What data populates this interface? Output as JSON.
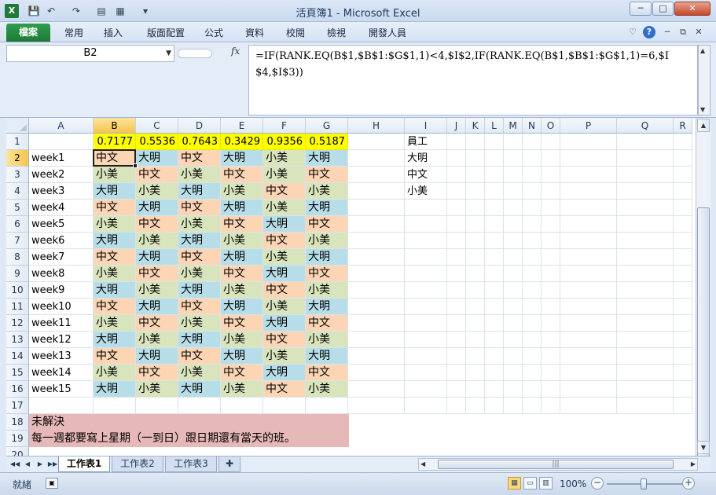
{
  "window": {
    "title": "活頁簿1 - Microsoft Excel",
    "minimize_label": "─",
    "maximize_label": "□",
    "close_label": "✕"
  },
  "quick_access": {
    "save_icon": "💾",
    "undo_icon": "↶",
    "redo_icon": "↷",
    "customize_icon": "▾"
  },
  "ribbon": {
    "tabs": [
      "檔案",
      "常用",
      "插入",
      "版面配置",
      "公式",
      "資料",
      "校閱",
      "檢視",
      "開發人員"
    ],
    "help_label": "?"
  },
  "formula_bar": {
    "name_box": "B2",
    "fx_label": "fx",
    "formula": "=IF(RANK.EQ(B$1,$B$1:$G$1,1)<4,$I$2,IF(RANK.EQ(B$1,$B$1:$G$1,1)=6,$I$4,$I$3))"
  },
  "grid": {
    "columns": [
      "A",
      "B",
      "C",
      "D",
      "E",
      "F",
      "G",
      "H",
      "I",
      "J",
      "K",
      "L",
      "M",
      "N",
      "O",
      "P",
      "Q",
      "R"
    ],
    "selected_column": "B",
    "selected_row": 2,
    "row_numbers": [
      1,
      2,
      3,
      4,
      5,
      6,
      7,
      8,
      9,
      10,
      11,
      12,
      13,
      14,
      15,
      16,
      17,
      18,
      19,
      20
    ],
    "row1_values": [
      "0.7177",
      "0.5536",
      "0.7643",
      "0.3429",
      "0.9356",
      "0.5187"
    ],
    "week_labels": [
      "week1",
      "week2",
      "week3",
      "week4",
      "week5",
      "week6",
      "week7",
      "week8",
      "week9",
      "week10",
      "week11",
      "week12",
      "week13",
      "week14",
      "week15"
    ],
    "schedule": [
      [
        "中文",
        "大明",
        "中文",
        "大明",
        "小美",
        "大明"
      ],
      [
        "小美",
        "中文",
        "小美",
        "中文",
        "小美",
        "中文"
      ],
      [
        "大明",
        "小美",
        "大明",
        "小美",
        "中文",
        "小美"
      ],
      [
        "中文",
        "大明",
        "中文",
        "大明",
        "小美",
        "大明"
      ],
      [
        "小美",
        "中文",
        "小美",
        "中文",
        "大明",
        "中文"
      ],
      [
        "大明",
        "小美",
        "大明",
        "小美",
        "中文",
        "小美"
      ],
      [
        "中文",
        "大明",
        "中文",
        "大明",
        "小美",
        "大明"
      ],
      [
        "小美",
        "中文",
        "小美",
        "中文",
        "大明",
        "中文"
      ],
      [
        "大明",
        "小美",
        "大明",
        "小美",
        "中文",
        "小美"
      ],
      [
        "中文",
        "大明",
        "中文",
        "大明",
        "小美",
        "大明"
      ],
      [
        "小美",
        "中文",
        "小美",
        "中文",
        "大明",
        "中文"
      ],
      [
        "大明",
        "小美",
        "大明",
        "小美",
        "中文",
        "小美"
      ],
      [
        "中文",
        "大明",
        "中文",
        "大明",
        "小美",
        "大明"
      ],
      [
        "小美",
        "中文",
        "小美",
        "中文",
        "大明",
        "中文"
      ],
      [
        "大明",
        "小美",
        "大明",
        "小美",
        "中文",
        "小美"
      ]
    ],
    "employee_header": "員工",
    "employees": [
      "大明",
      "中文",
      "小美"
    ],
    "colors": {
      "中文": "#fcd5b4",
      "大明": "#b7dee8",
      "小美": "#d8e4bc",
      "row1": "#ffff00",
      "note": "#e6b8b7"
    },
    "note_line1": "未解決",
    "note_line2": "每一週都要寫上星期（一到日）跟日期還有當天的班。"
  },
  "sheets": {
    "tabs": [
      "工作表1",
      "工作表2",
      "工作表3"
    ],
    "active": "工作表1",
    "new_sheet_icon": "✚"
  },
  "status": {
    "text": "就緒",
    "zoom": "100%",
    "zoom_out": "−",
    "zoom_in": "+"
  }
}
